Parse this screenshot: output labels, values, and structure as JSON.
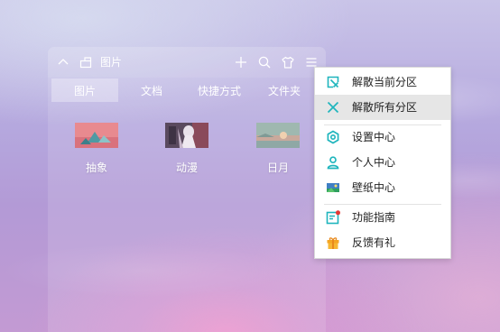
{
  "box": {
    "title": "图片",
    "tabs": [
      {
        "label": "图片",
        "active": true
      },
      {
        "label": "文档",
        "active": false
      },
      {
        "label": "快捷方式",
        "active": false
      },
      {
        "label": "文件夹",
        "active": false
      }
    ],
    "items": [
      {
        "label": "抽象",
        "icon": "abstract-image-thumbnail"
      },
      {
        "label": "动漫",
        "icon": "anime-image-thumbnail"
      },
      {
        "label": "日月",
        "icon": "sun-moon-image-thumbnail"
      }
    ]
  },
  "menu": {
    "items": [
      {
        "label": "解散当前分区",
        "icon": "dissolve-current-icon",
        "highlighted": false
      },
      {
        "label": "解散所有分区",
        "icon": "dissolve-all-icon",
        "highlighted": true
      },
      {
        "label": "设置中心",
        "icon": "settings-icon",
        "highlighted": false
      },
      {
        "label": "个人中心",
        "icon": "user-icon",
        "highlighted": false
      },
      {
        "label": "壁纸中心",
        "icon": "wallpaper-icon",
        "highlighted": false
      },
      {
        "label": "功能指南",
        "icon": "guide-icon",
        "highlighted": false
      },
      {
        "label": "反馈有礼",
        "icon": "gift-icon",
        "highlighted": false
      }
    ]
  },
  "colors": {
    "accent": "#1fb5bd",
    "gift": "#f5a623",
    "notify": "#e53935"
  }
}
